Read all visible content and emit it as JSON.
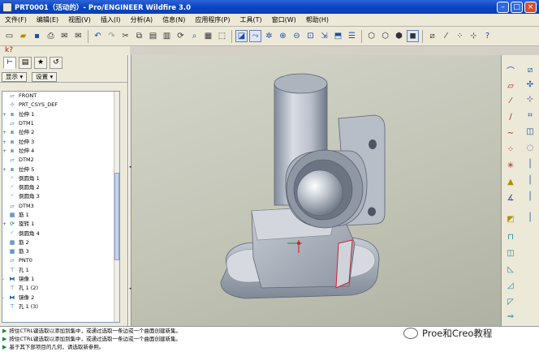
{
  "window": {
    "title": "PRT0001（活动的）- Pro/ENGINEER Wildfire 3.0"
  },
  "menu": [
    "文件(F)",
    "编辑(E)",
    "视图(V)",
    "插入(I)",
    "分析(A)",
    "信息(N)",
    "应用程序(P)",
    "工具(T)",
    "窗口(W)",
    "帮助(H)"
  ],
  "panel": {
    "show_label": "显示 ▾",
    "settings_label": "设置 ▾"
  },
  "tree": [
    {
      "icon": "plane-icon",
      "label": "FRONT",
      "exp": ""
    },
    {
      "icon": "csys-icon",
      "label": "PRT_CSYS_DEF",
      "exp": ""
    },
    {
      "icon": "extrude-icon",
      "label": "拉伸 1",
      "exp": "+"
    },
    {
      "icon": "plane-icon",
      "label": "DTM1",
      "exp": ""
    },
    {
      "icon": "extrude-icon",
      "label": "拉伸 2",
      "exp": "+"
    },
    {
      "icon": "extrude-icon",
      "label": "拉伸 3",
      "exp": "+"
    },
    {
      "icon": "extrude-icon",
      "label": "拉伸 4",
      "exp": "+"
    },
    {
      "icon": "plane-icon",
      "label": "DTM2",
      "exp": ""
    },
    {
      "icon": "extrude-icon",
      "label": "拉伸 5",
      "exp": "+"
    },
    {
      "icon": "round-icon",
      "label": "倒圆角 1",
      "exp": ""
    },
    {
      "icon": "round-icon",
      "label": "倒圆角 2",
      "exp": ""
    },
    {
      "icon": "round-icon",
      "label": "倒圆角 3",
      "exp": ""
    },
    {
      "icon": "plane-icon",
      "label": "DTM3",
      "exp": ""
    },
    {
      "icon": "rib-icon",
      "label": "筋 1",
      "exp": ""
    },
    {
      "icon": "sweep-icon",
      "label": "旋转 1",
      "exp": "+"
    },
    {
      "icon": "round-icon",
      "label": "倒圆角 4",
      "exp": ""
    },
    {
      "icon": "rib-icon",
      "label": "筋 2",
      "exp": ""
    },
    {
      "icon": "rib-icon",
      "label": "筋 3",
      "exp": ""
    },
    {
      "icon": "plane-icon",
      "label": "PNT0",
      "exp": ""
    },
    {
      "icon": "hole-icon",
      "label": "孔 1",
      "exp": ""
    },
    {
      "icon": "mirror-icon",
      "label": "镜像 1",
      "exp": "-"
    },
    {
      "icon": "hole-icon",
      "label": "孔 1 (2)",
      "exp": ""
    },
    {
      "icon": "mirror-icon",
      "label": "镜像 2",
      "exp": "-"
    },
    {
      "icon": "hole-icon",
      "label": "孔 1 (3)",
      "exp": ""
    }
  ],
  "status": [
    "按住CTRL键选取以添加到集中，或通过选取一条边或一个曲面创建新集。",
    "按住CTRL键选取以添加到集中，或通过选取一条边或一个曲面创建新集。",
    "基于其下部项目的几何，请选取新参照。"
  ],
  "watermark": "Proe和Creo教程"
}
